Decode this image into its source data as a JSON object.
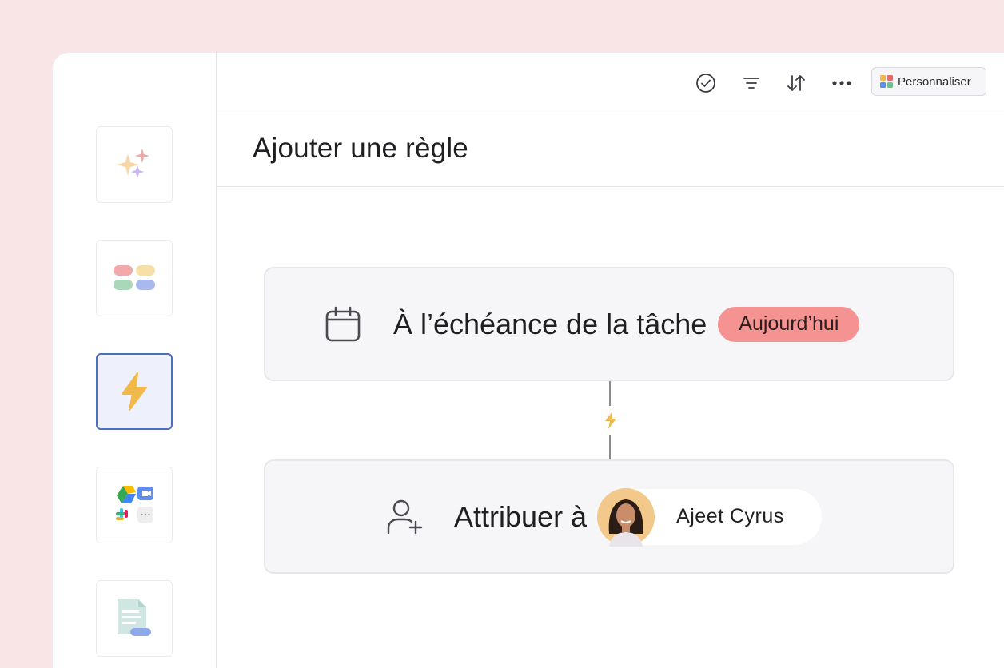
{
  "toolbar": {
    "icons": [
      "check-circle-icon",
      "filter-icon",
      "sort-icon",
      "more-icon"
    ],
    "personalize_label": "Personnaliser"
  },
  "sidebar": {
    "tiles": [
      {
        "name": "ai-sparkle-tile",
        "icon": "sparkle-icon"
      },
      {
        "name": "fields-tile",
        "icon": "fields-icon"
      },
      {
        "name": "rules-tile",
        "icon": "lightning-icon",
        "active": true
      },
      {
        "name": "integrations-tile",
        "icon": "apps-icon"
      },
      {
        "name": "templates-tile",
        "icon": "document-icon"
      }
    ]
  },
  "header": {
    "title": "Ajouter une règle"
  },
  "trigger": {
    "text": "À l’échéance de la tâche",
    "badge": "Aujourd’hui",
    "icon": "calendar-icon"
  },
  "action": {
    "text": "Attribuer à",
    "assignee": "Ajeet Cyrus",
    "icon": "add-user-icon"
  },
  "colors": {
    "accent": "#4d6fc2",
    "badge": "#f59292",
    "bolt": "#f0b94a"
  }
}
